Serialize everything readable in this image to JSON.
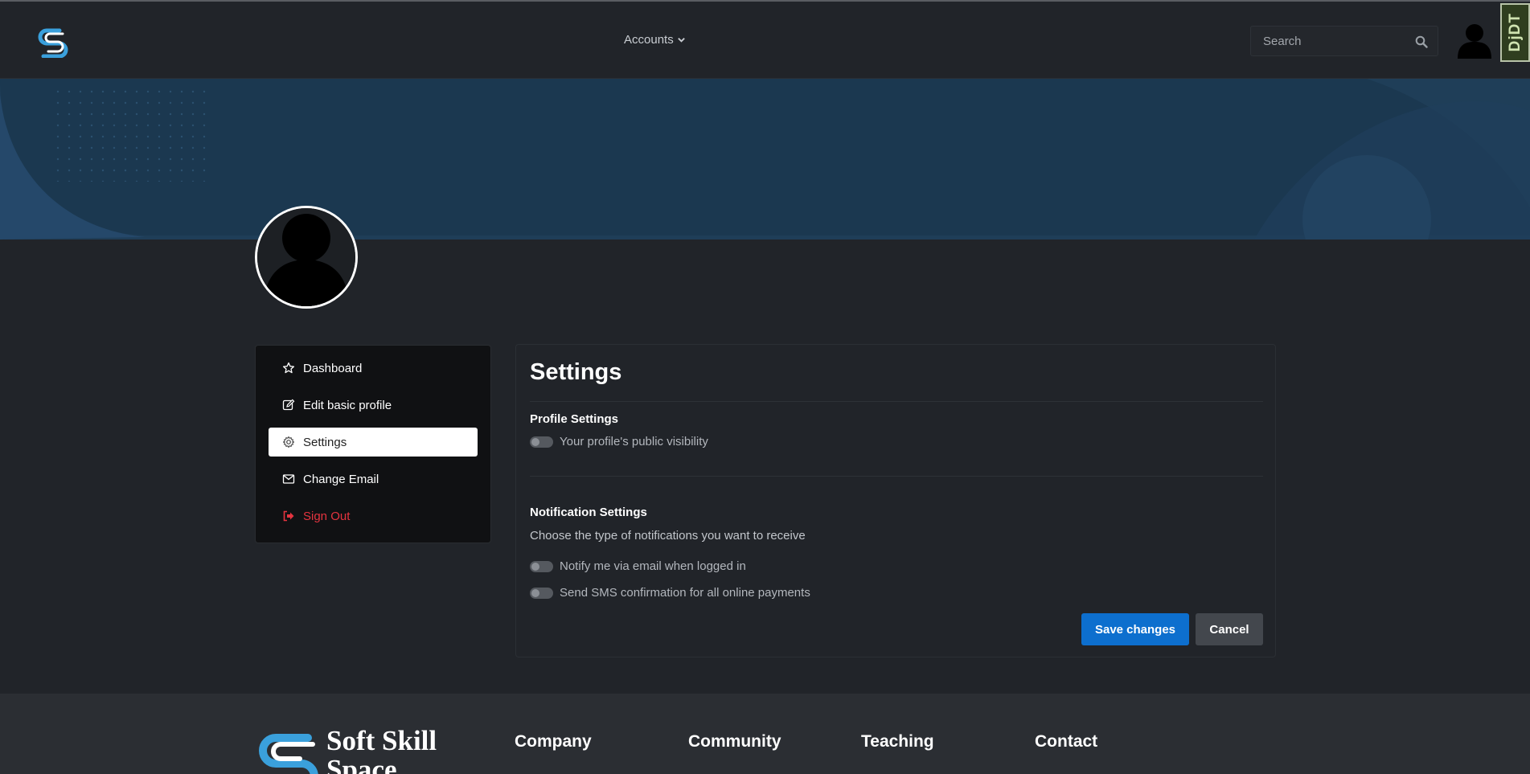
{
  "nav": {
    "accounts_label": "Accounts",
    "search_placeholder": "Search",
    "debug_toolbar_label": "DjDT"
  },
  "sidebar": {
    "items": [
      {
        "label": "Dashboard",
        "icon": "star-icon"
      },
      {
        "label": "Edit basic profile",
        "icon": "edit-icon"
      },
      {
        "label": "Settings",
        "icon": "gear-icon",
        "active": true
      },
      {
        "label": "Change Email",
        "icon": "envelope-icon"
      },
      {
        "label": "Sign Out",
        "icon": "sign-out-icon"
      }
    ]
  },
  "settings": {
    "title": "Settings",
    "profile": {
      "heading": "Profile Settings",
      "visibility_label": "Your profile's public visibility",
      "visibility_on": false
    },
    "notifications": {
      "heading": "Notification Settings",
      "description": "Choose the type of notifications you want to receive",
      "email_label": "Notify me via email when logged in",
      "email_on": false,
      "sms_label": "Send SMS confirmation for all online payments",
      "sms_on": false
    },
    "save_label": "Save changes",
    "cancel_label": "Cancel"
  },
  "footer": {
    "brand_line1": "Soft Skill",
    "brand_line2": "Space",
    "columns": [
      "Company",
      "Community",
      "Teaching",
      "Contact"
    ]
  },
  "colors": {
    "background": "#212429",
    "banner": "#1f3e58",
    "accent_blue": "#0d6fce",
    "logo_blue": "#3aa0dc",
    "danger": "#e5343f"
  }
}
